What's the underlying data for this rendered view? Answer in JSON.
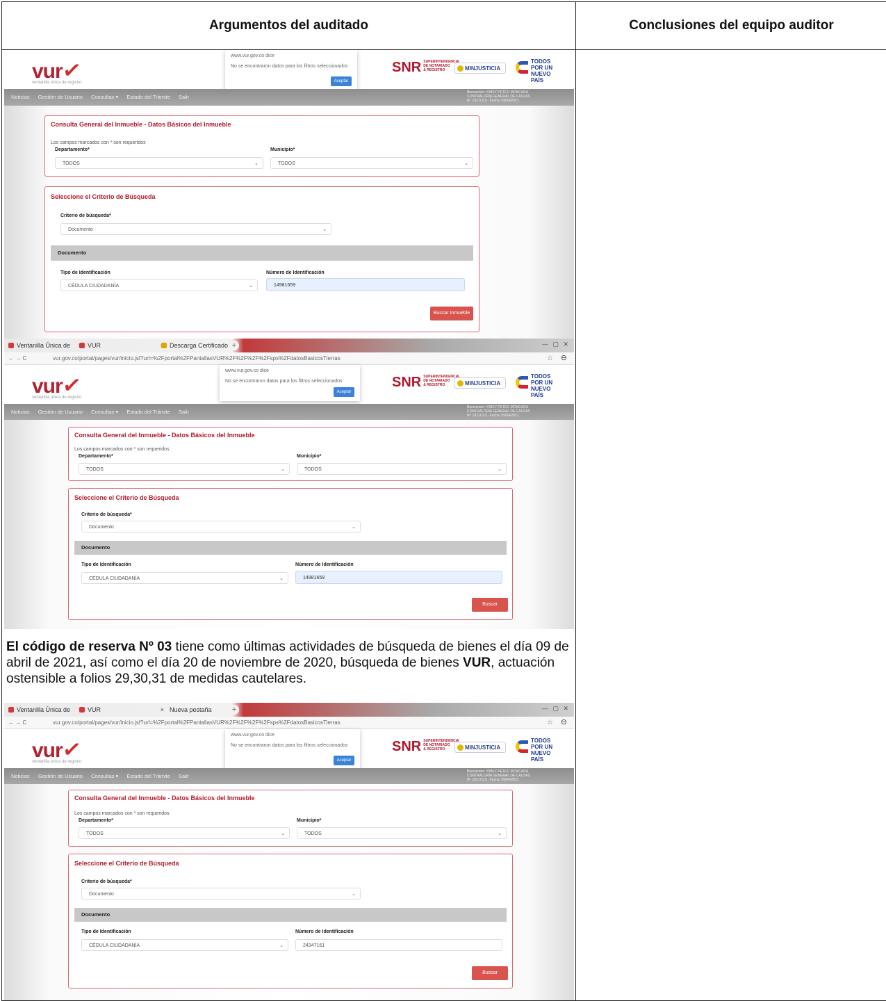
{
  "table": {
    "col_left_header": "Argumentos del auditado",
    "col_right_header": "Conclusiones del equipo auditor"
  },
  "screens": {
    "browser": {
      "tab1": "Ventanilla Única de Registro",
      "tab2": "VUR",
      "tab3_shot2": "Descarga Certificado de Bus...",
      "tab3_shot3": "Nueva pestaña",
      "nav": "←  →  C",
      "url": "vur.gov.co/portal/pages/vur/inicio.jsf?url=%2Fportal%2FPantallasVUR%2F%2F%2F%2Fsps%2FdatosBasicosTierras",
      "star": "☆",
      "account": "⊖",
      "window_controls": "— ▢ ✕"
    },
    "banner": {
      "vur_text": "vur",
      "vur_sub": "ventanilla única de registro",
      "alert_site": "www.vur.gov.co dice",
      "alert_msg": "No se encontraron datos para los filtros seleccionados",
      "alert_btn": "Aceptar",
      "snr": "SNR",
      "snr_sub": "SUPERINTENDENCIA DE NOTARIADO & REGISTRO",
      "minjusticia": "MINJUSTICIA",
      "pais": "TODOS POR UN NUEVO PAÍS"
    },
    "menu": {
      "items": [
        "Noticias",
        "Gestión de Usuario",
        "Consultas ▾",
        "Estado del Trámite",
        "Salir"
      ],
      "user_line1": "Bienvenido: YIMEY PETEO MONCADA",
      "user_line2": "CONTRALORÍA GENERAL DE CALDAS",
      "user_line3": "IP: 192.0.0.0  ·  Fecha: 09/04/2021"
    },
    "panel1": {
      "title": "Consulta General del Inmueble - Datos Básicos del Inmueble",
      "note": "Los campos marcados con * son requeridos",
      "dept_label": "Departamento*",
      "dept_value": "TODOS",
      "mun_label": "Municipio*",
      "mun_value": "TODOS"
    },
    "panel2": {
      "title": "Seleccione el Criterio de Búsqueda",
      "criterio_label": "Criterio de búsqueda*",
      "criterio_value": "Documento",
      "doc_header": "Documento",
      "tipo_label": "Tipo de Identificación",
      "tipo_value": "CÉDULA CIUDADANÍA",
      "num_label": "Número de Identificación",
      "num_value_a": "14981659",
      "num_value_b": "24347161",
      "search_btn": "Buscar Inmueble"
    },
    "chevron": "⌄"
  },
  "paragraph": {
    "bold_lead": "El código de reserva Nº 03",
    "text1": " tiene como últimas actividades de búsqueda de bienes el día 09 de abril de 2021, así como el día 20 de noviembre de 2020, búsqueda de bienes ",
    "bold_vur": "VUR",
    "text2": ", actuación ostensible a folios 29,30,31 de medidas cautelares."
  }
}
